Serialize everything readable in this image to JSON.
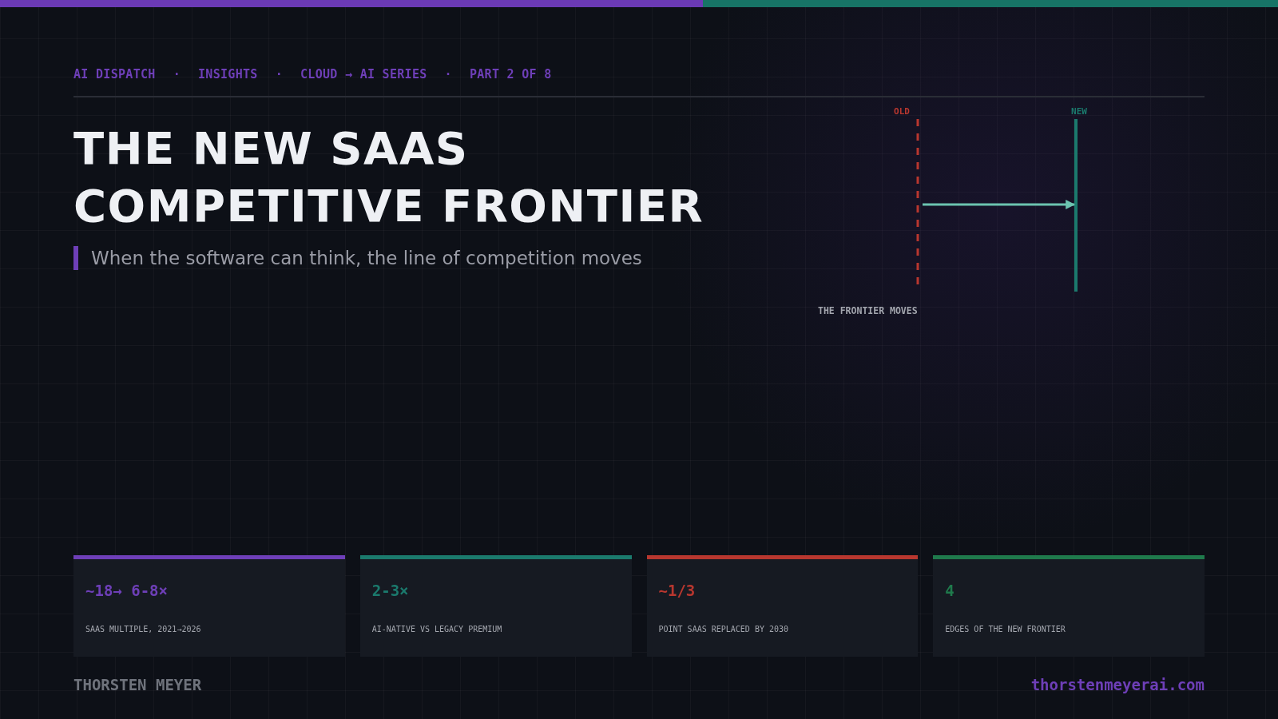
{
  "header": {
    "segments": [
      "AI DISPATCH",
      "INSIGHTS",
      "CLOUD → AI SERIES",
      "PART 2 OF 8"
    ],
    "separator": "·"
  },
  "title": {
    "lines": [
      "THE NEW SAAS",
      "COMPETITIVE FRONTIER"
    ]
  },
  "subtitle": "When the software can think, the line of competition moves",
  "diagram": {
    "old_label": "OLD",
    "new_label": "NEW",
    "caption": "THE FRONTIER MOVES"
  },
  "stats": [
    {
      "value": "~18→ 6-8×",
      "label": "SAAS MULTIPLE, 2021→2026",
      "color": "#6e3fb8"
    },
    {
      "value": "2-3×",
      "label": "AI-NATIVE VS LEGACY PREMIUM",
      "color": "#1b7a6d"
    },
    {
      "value": "~1/3",
      "label": "POINT SAAS REPLACED BY 2030",
      "color": "#b8372f"
    },
    {
      "value": "4",
      "label": "EDGES OF THE NEW FRONTIER",
      "color": "#1f7a4c"
    }
  ],
  "footer": {
    "author": "THORSTEN MEYER",
    "url": "thorstenmeyerai.com"
  }
}
